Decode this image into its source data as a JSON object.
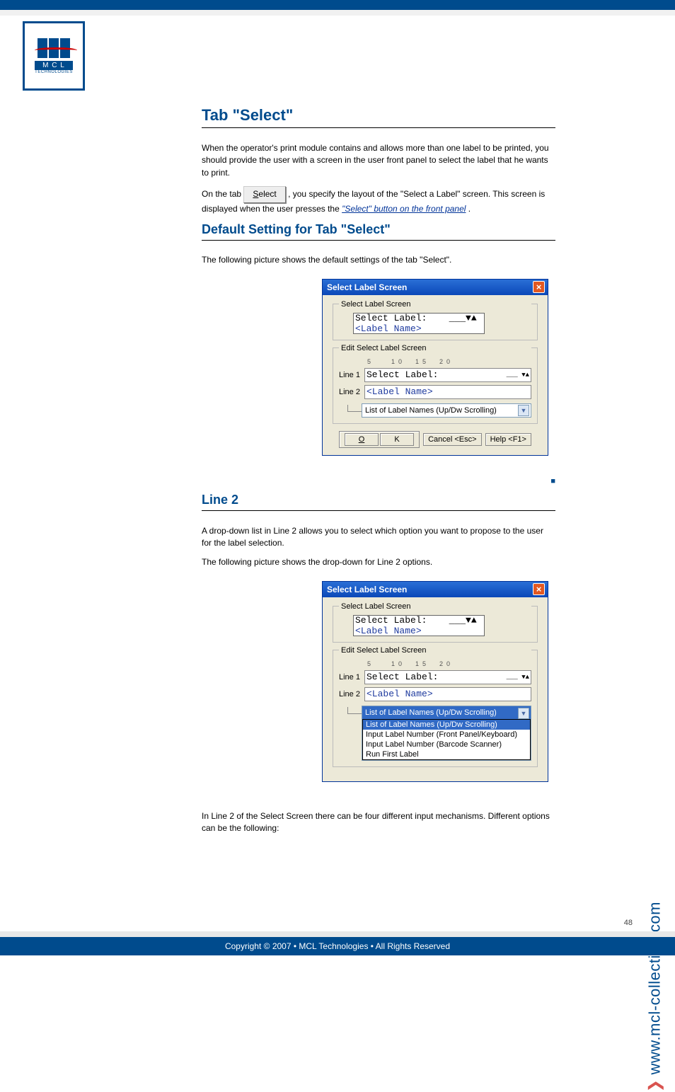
{
  "logo": {
    "letters": "M C L",
    "sub": "TECHNOLOGIES"
  },
  "page": {
    "section_title": "Tab \"Select\"",
    "p1": "When the operator's print module contains and allows more than one label to be printed, you should provide the user with a screen in the user front panel to select the label that he wants to print.",
    "p2a": "On the tab ",
    "p2_btn_u": "S",
    "p2_btn_rest": "elect",
    "p2b": ", you specify the layout of the \"Select a Label\" screen. This screen is displayed when the user presses the ",
    "link": "\"Select\" button on the front panel",
    "p2c": ".",
    "sub_default": "Default Setting for Tab \"Select\"",
    "intro_default": "The following picture shows the default settings of the tab \"Select\".",
    "dot_end": "■",
    "sub_line2": "Line 2",
    "p3": "A drop-down list in Line 2 allows you to select which option you want to propose to the user for the label selection.",
    "intro_dd": "The following picture shows the drop-down for Line 2 options.",
    "p4": "In Line 2 of the Select Screen there can be four different input mechanisms. Different options can be the following:"
  },
  "dialog": {
    "title": "Select Label  Screen",
    "fs1": "Select Label  Screen",
    "preview_l1_a": "Select Label:",
    "preview_l1_end": "___▼▲",
    "preview_l2": "<Label Name>",
    "fs2": "Edit Select Label  Screen",
    "ruler": [
      "5",
      "10",
      "15",
      "20"
    ],
    "line1_lbl": "Line 1",
    "line1_val": "Select Label:",
    "line1_end": "___ ▼▲",
    "line2_lbl": "Line 2",
    "line2_val": "<Label Name>",
    "dd_value": "List of Label Names (Up/Dw Scrolling)",
    "dd_options": [
      "List of Label Names (Up/Dw Scrolling)",
      "Input Label Number (Front Panel/Keyboard)",
      "Input Label Number (Barcode Scanner)",
      "Run First Label"
    ],
    "btn_ok_u": "O",
    "btn_ok_rest": "K",
    "btn_cancel": "Cancel <Esc>",
    "btn_help": "Help <F1>"
  },
  "footer": "Copyright © 2007 • MCL Technologies • All Rights Reserved",
  "url_prefix": "❯",
  "url": "www.mcl-collection.com",
  "page_num": "48"
}
